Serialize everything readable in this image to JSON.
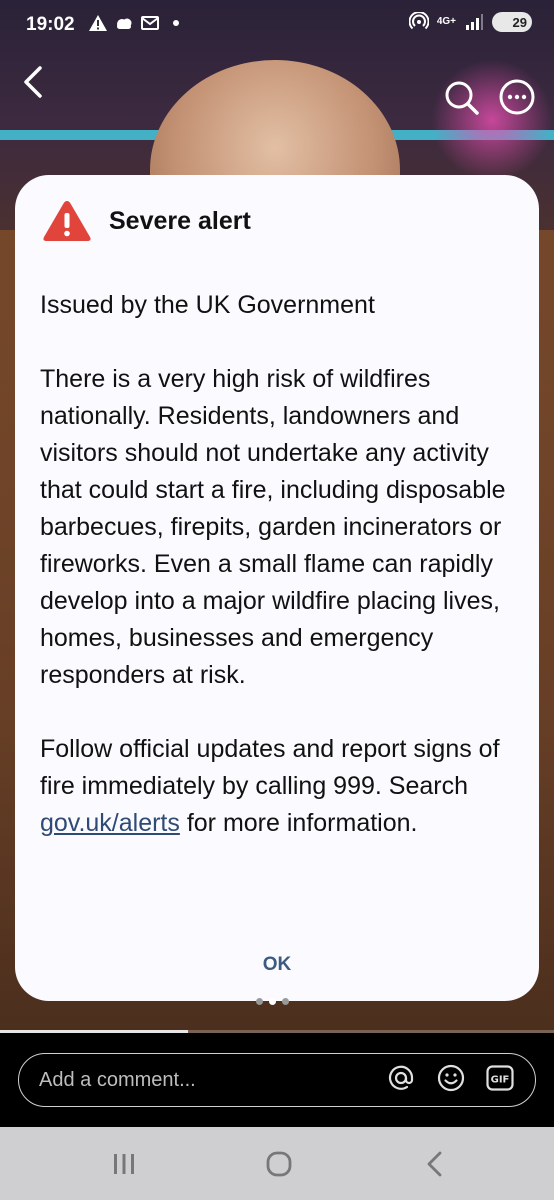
{
  "status": {
    "time": "19:02",
    "network": "4G+",
    "battery": "29"
  },
  "icons": {
    "back": "chevron-left-icon",
    "search": "search-icon",
    "more": "more-icon",
    "warning": "warning-triangle-icon",
    "mention": "at-icon",
    "emoji": "emoji-icon",
    "gif": "gif-icon"
  },
  "alert": {
    "title": "Severe alert",
    "issuer": "Issued by the UK Government",
    "message": "There is a very high risk of wildfires nationally. Residents, landowners and visitors should not undertake any activity that could start a fire, including disposable barbecues, firepits, garden incinerators or fireworks. Even a small flame can rapidly develop into a major wildfire placing lives, homes, businesses and emergency responders at risk.",
    "follow_pre": "Follow official updates and report signs of fire immediately by calling 999. Search ",
    "link": "gov.uk/alerts",
    "follow_post": " for more information.",
    "ok_label": "OK",
    "warning_color": "#e0443a"
  },
  "video": {
    "progress": 0.34,
    "page_count": 3,
    "page_active": 2
  },
  "comment": {
    "placeholder": "Add a comment...",
    "gif_label": "GIF"
  }
}
